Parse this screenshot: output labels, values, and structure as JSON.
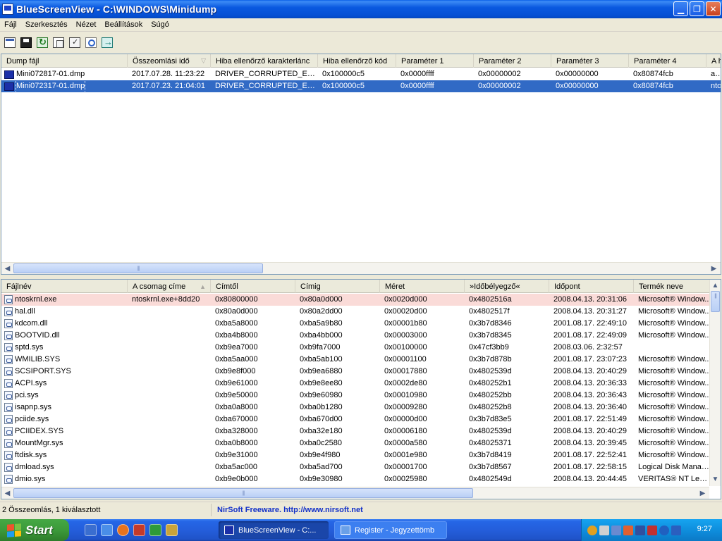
{
  "window": {
    "title": "BlueScreenView  -  C:\\WINDOWS\\Minidump"
  },
  "menu": [
    "Fájl",
    "Szerkesztés",
    "Nézet",
    "Beállítások",
    "Súgó"
  ],
  "toolbar_icons": [
    "open-report-icon",
    "save-icon",
    "refresh-icon",
    "copy-icon",
    "properties-icon",
    "find-icon",
    "exit-icon"
  ],
  "dumps": {
    "columns": [
      "Dump fájl",
      "Összeomlási idő",
      "Hiba ellenőrző karakterlánc",
      "Hiba ellenőrző kód",
      "Paraméter 1",
      "Paraméter 2",
      "Paraméter 3",
      "Paraméter 4",
      "A h"
    ],
    "sort_glyph": "▽",
    "rows": [
      [
        "Mini072817-01.dmp",
        "2017.07.28. 11:23:22",
        "DRIVER_CORRUPTED_EX...",
        "0x100000c5",
        "0x0000ffff",
        "0x00000002",
        "0x00000000",
        "0x80874fcb",
        "asw"
      ],
      [
        "Mini072317-01.dmp",
        "2017.07.23. 21:04:01",
        "DRIVER_CORRUPTED_EX...",
        "0x100000c5",
        "0x0000ffff",
        "0x00000002",
        "0x00000000",
        "0x80874fcb",
        "nto"
      ]
    ],
    "selected_row": 1
  },
  "modules": {
    "columns": [
      "Fájlnév",
      "A csomag címe",
      "Címtől",
      "Címig",
      "Méret",
      "»Időbélyegző«",
      "Időpont",
      "Termék neve"
    ],
    "sort_glyph": "▲",
    "rows": [
      [
        "ntoskrnl.exe",
        "ntoskrnl.exe+8dd20",
        "0x80800000",
        "0x80a0d000",
        "0x0020d000",
        "0x4802516a",
        "2008.04.13. 20:31:06",
        "Microsoft® Window..."
      ],
      [
        "hal.dll",
        "",
        "0x80a0d000",
        "0x80a2dd00",
        "0x00020d00",
        "0x4802517f",
        "2008.04.13. 20:31:27",
        "Microsoft® Window..."
      ],
      [
        "kdcom.dll",
        "",
        "0xba5a8000",
        "0xba5a9b80",
        "0x00001b80",
        "0x3b7d8346",
        "2001.08.17. 22:49:10",
        "Microsoft® Window..."
      ],
      [
        "BOOTVID.dll",
        "",
        "0xba4b8000",
        "0xba4bb000",
        "0x00003000",
        "0x3b7d8345",
        "2001.08.17. 22:49:09",
        "Microsoft® Window..."
      ],
      [
        "sptd.sys",
        "",
        "0xb9ea7000",
        "0xb9fa7000",
        "0x00100000",
        "0x47cf3bb9",
        "2008.03.06. 2:32:57",
        ""
      ],
      [
        "WMILIB.SYS",
        "",
        "0xba5aa000",
        "0xba5ab100",
        "0x00001100",
        "0x3b7d878b",
        "2001.08.17. 23:07:23",
        "Microsoft® Window..."
      ],
      [
        "SCSIPORT.SYS",
        "",
        "0xb9e8f000",
        "0xb9ea6880",
        "0x00017880",
        "0x4802539d",
        "2008.04.13. 20:40:29",
        "Microsoft® Window..."
      ],
      [
        "ACPI.sys",
        "",
        "0xb9e61000",
        "0xb9e8ee80",
        "0x0002de80",
        "0x480252b1",
        "2008.04.13. 20:36:33",
        "Microsoft® Window..."
      ],
      [
        "pci.sys",
        "",
        "0xb9e50000",
        "0xb9e60980",
        "0x00010980",
        "0x480252bb",
        "2008.04.13. 20:36:43",
        "Microsoft® Window..."
      ],
      [
        "isapnp.sys",
        "",
        "0xba0a8000",
        "0xba0b1280",
        "0x00009280",
        "0x480252b8",
        "2008.04.13. 20:36:40",
        "Microsoft® Window..."
      ],
      [
        "pciide.sys",
        "",
        "0xba670000",
        "0xba670d00",
        "0x00000d00",
        "0x3b7d83e5",
        "2001.08.17. 22:51:49",
        "Microsoft® Window..."
      ],
      [
        "PCIIDEX.SYS",
        "",
        "0xba328000",
        "0xba32e180",
        "0x00006180",
        "0x4802539d",
        "2008.04.13. 20:40:29",
        "Microsoft® Window..."
      ],
      [
        "MountMgr.sys",
        "",
        "0xba0b8000",
        "0xba0c2580",
        "0x0000a580",
        "0x48025371",
        "2008.04.13. 20:39:45",
        "Microsoft® Window..."
      ],
      [
        "ftdisk.sys",
        "",
        "0xb9e31000",
        "0xb9e4f980",
        "0x0001e980",
        "0x3b7d8419",
        "2001.08.17. 22:52:41",
        "Microsoft® Window..."
      ],
      [
        "dmload.sys",
        "",
        "0xba5ac000",
        "0xba5ad700",
        "0x00001700",
        "0x3b7d8567",
        "2001.08.17. 22:58:15",
        "Logical Disk Manage..."
      ],
      [
        "dmio.sys",
        "",
        "0xb9e0b000",
        "0xb9e30980",
        "0x00025980",
        "0x4802549d",
        "2008.04.13. 20:44:45",
        "VERITAS® NT Leme..."
      ]
    ],
    "highlight_row": 0
  },
  "status": {
    "summary": "2 Összeomlás, 1 kiválasztott",
    "credit": "NirSoft Freeware.  http://www.nirsoft.net"
  },
  "taskbar": {
    "start_label": "Start",
    "tasks": [
      "BlueScreenView  -  C:...",
      "Register - Jegyzettömb"
    ],
    "active_task": 0,
    "clock": "9:27"
  }
}
